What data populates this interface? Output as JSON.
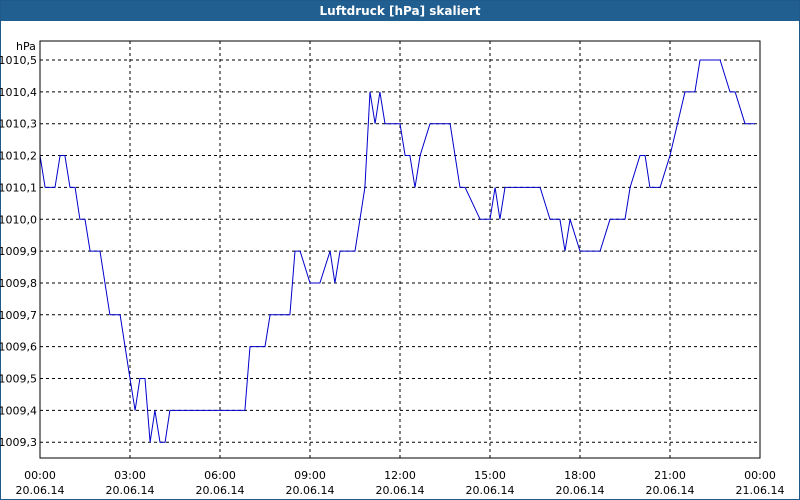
{
  "window": {
    "title": "Luftdruck [hPa] skaliert"
  },
  "colors": {
    "titlebar": "#215f91",
    "series": "#0000cc",
    "grid": "#000000"
  },
  "chart_data": {
    "type": "line",
    "title": "Luftdruck [hPa] skaliert",
    "ylabel": "hPa",
    "grid": true,
    "ylim": [
      1009.25,
      1010.55
    ],
    "x_range_hours": [
      0,
      24
    ],
    "yticks": [
      "1009,3",
      "1009,4",
      "1009,5",
      "1009,6",
      "1009,7",
      "1009,8",
      "1009,9",
      "1010,0",
      "1010,1",
      "1010,2",
      "1010,3",
      "1010,4",
      "1010,5"
    ],
    "ytick_values": [
      1009.3,
      1009.4,
      1009.5,
      1009.6,
      1009.7,
      1009.8,
      1009.9,
      1010.0,
      1010.1,
      1010.2,
      1010.3,
      1010.4,
      1010.5
    ],
    "xticks": [
      {
        "time": "00:00",
        "date": "20.06.14"
      },
      {
        "time": "03:00",
        "date": "20.06.14"
      },
      {
        "time": "06:00",
        "date": "20.06.14"
      },
      {
        "time": "09:00",
        "date": "20.06.14"
      },
      {
        "time": "12:00",
        "date": "20.06.14"
      },
      {
        "time": "15:00",
        "date": "20.06.14"
      },
      {
        "time": "18:00",
        "date": "20.06.14"
      },
      {
        "time": "21:00",
        "date": "20.06.14"
      },
      {
        "time": "00:00",
        "date": "21.06.14"
      }
    ],
    "series": [
      {
        "x_hours": [
          0,
          0.17,
          0.5,
          0.67,
          0.83,
          1.0,
          1.17,
          1.33,
          1.5,
          1.67,
          1.83,
          2.0,
          2.33,
          2.5,
          2.67,
          3.0,
          3.17,
          3.33,
          3.5,
          3.67,
          3.83,
          4.0,
          4.17,
          4.33,
          4.5,
          4.67,
          5.0,
          5.5,
          6.0,
          6.5,
          6.83,
          7.0,
          7.17,
          7.5,
          7.67,
          8.0,
          8.33,
          8.5,
          8.67,
          9.0,
          9.33,
          9.67,
          9.83,
          10.0,
          10.17,
          10.5,
          10.83,
          11.0,
          11.17,
          11.33,
          11.5,
          11.67,
          12.0,
          12.17,
          12.33,
          12.5,
          12.67,
          13.0,
          13.5,
          13.67,
          14.0,
          14.17,
          14.67,
          15.0,
          15.17,
          15.33,
          15.5,
          16.0,
          16.5,
          16.67,
          17.0,
          17.17,
          17.33,
          17.5,
          17.67,
          18.0,
          18.5,
          18.67,
          19.0,
          19.5,
          19.67,
          20.0,
          20.17,
          20.33,
          20.5,
          20.67,
          21.0,
          21.5,
          21.83,
          22.0,
          22.33,
          22.67,
          23.0,
          23.17,
          23.5,
          23.83
        ],
        "values": [
          1010.2,
          1010.1,
          1010.1,
          1010.2,
          1010.2,
          1010.1,
          1010.1,
          1010.0,
          1010.0,
          1009.9,
          1009.9,
          1009.9,
          1009.7,
          1009.7,
          1009.7,
          1009.5,
          1009.4,
          1009.5,
          1009.5,
          1009.3,
          1009.4,
          1009.3,
          1009.3,
          1009.4,
          1009.4,
          1009.4,
          1009.4,
          1009.4,
          1009.4,
          1009.4,
          1009.4,
          1009.6,
          1009.6,
          1009.6,
          1009.7,
          1009.7,
          1009.7,
          1009.9,
          1009.9,
          1009.8,
          1009.8,
          1009.9,
          1009.8,
          1009.9,
          1009.9,
          1009.9,
          1010.1,
          1010.4,
          1010.3,
          1010.4,
          1010.3,
          1010.3,
          1010.3,
          1010.2,
          1010.2,
          1010.1,
          1010.2,
          1010.3,
          1010.3,
          1010.3,
          1010.1,
          1010.1,
          1010.0,
          1010.0,
          1010.1,
          1010.0,
          1010.1,
          1010.1,
          1010.1,
          1010.1,
          1010.0,
          1010.0,
          1010.0,
          1009.9,
          1010.0,
          1009.9,
          1009.9,
          1009.9,
          1010.0,
          1010.0,
          1010.1,
          1010.2,
          1010.2,
          1010.1,
          1010.1,
          1010.1,
          1010.2,
          1010.4,
          1010.4,
          1010.5,
          1010.5,
          1010.5,
          1010.4,
          1010.4,
          1010.3,
          1010.3
        ]
      }
    ]
  }
}
